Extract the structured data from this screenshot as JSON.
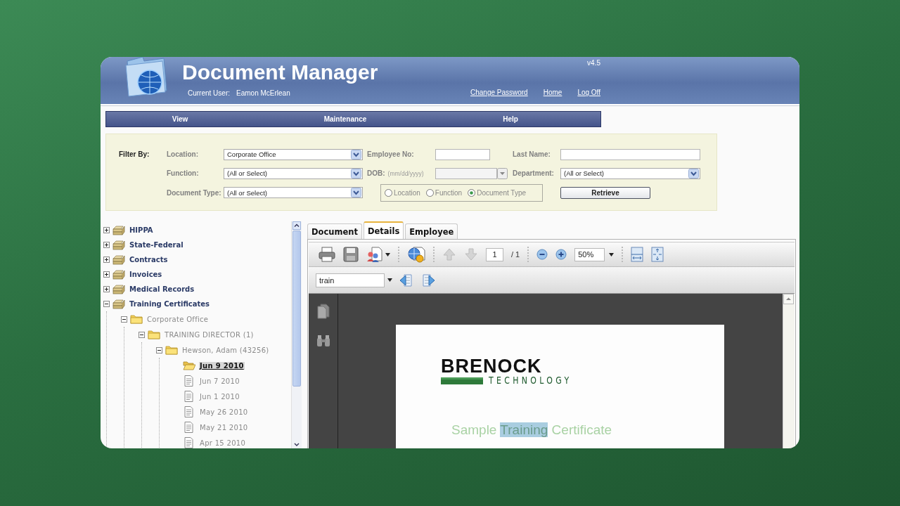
{
  "app": {
    "title": "Document Manager",
    "version": "v4.5",
    "user_label": "Current User:",
    "user_name": "Eamon McErlean",
    "links": [
      "Change Password",
      "Home",
      "Log Off"
    ]
  },
  "menu": [
    "View",
    "Maintenance",
    "Help"
  ],
  "filter": {
    "title": "Filter By:",
    "location": {
      "label": "Location:",
      "value": "Corporate Office"
    },
    "function": {
      "label": "Function:",
      "value": "(All or Select)"
    },
    "document_type": {
      "label": "Document Type:",
      "value": "(All or Select)"
    },
    "employee_no": {
      "label": "Employee No:"
    },
    "dob": {
      "label": "DOB:",
      "hint": "(mm/dd/yyyy)"
    },
    "last_name": {
      "label": "Last Name:"
    },
    "department": {
      "label": "Department:",
      "value": "(All or Select)"
    },
    "group_by": [
      {
        "label": "Location",
        "selected": false
      },
      {
        "label": "Function",
        "selected": false
      },
      {
        "label": "Document Type",
        "selected": true
      }
    ],
    "retrieve": "Retrieve"
  },
  "tree": [
    {
      "label": "HIPPA",
      "kind": "cabinet",
      "expanded": false,
      "selected": false
    },
    {
      "label": "State-Federal",
      "kind": "cabinet",
      "expanded": false,
      "selected": false
    },
    {
      "label": "Contracts",
      "kind": "cabinet",
      "expanded": false,
      "selected": false
    },
    {
      "label": "Invoices",
      "kind": "cabinet",
      "expanded": false,
      "selected": false
    },
    {
      "label": "Medical Records",
      "kind": "cabinet",
      "expanded": false,
      "selected": false
    },
    {
      "label": "Training Certificates",
      "kind": "cabinet",
      "expanded": true,
      "selected": false,
      "children": [
        {
          "label": "Corporate Office",
          "kind": "folder",
          "expanded": true,
          "selected": false,
          "children": [
            {
              "label": "TRAINING DIRECTOR (1)",
              "kind": "folder",
              "expanded": true,
              "selected": false,
              "children": [
                {
                  "label": "Hewson, Adam (43256)",
                  "kind": "folder",
                  "expanded": true,
                  "selected": false,
                  "children": [
                    {
                      "label": "Jun 9 2010",
                      "kind": "folder",
                      "selected": true
                    },
                    {
                      "label": "Jun 7 2010",
                      "kind": "file",
                      "selected": false
                    },
                    {
                      "label": "Jun 1 2010",
                      "kind": "file",
                      "selected": false
                    },
                    {
                      "label": "May 26 2010",
                      "kind": "file",
                      "selected": false
                    },
                    {
                      "label": "May 21 2010",
                      "kind": "file",
                      "selected": false
                    },
                    {
                      "label": "Apr 15 2010",
                      "kind": "file",
                      "selected": false
                    }
                  ]
                }
              ]
            }
          ]
        }
      ]
    }
  ],
  "tabs": [
    {
      "label": "Document",
      "selected": false
    },
    {
      "label": "Details",
      "selected": true
    },
    {
      "label": "Employee",
      "selected": false
    }
  ],
  "viewer": {
    "page": "1",
    "page_total": "/ 1",
    "zoom": "50%",
    "search": "train"
  },
  "document": {
    "logo_name": "BRENOCK",
    "logo_tagline": "TECHNOLOGY",
    "heading": [
      {
        "text": "Sample ",
        "highlighted": false
      },
      {
        "text": "Training",
        "highlighted": true
      },
      {
        "text": " Certificate",
        "highlighted": false
      }
    ]
  }
}
